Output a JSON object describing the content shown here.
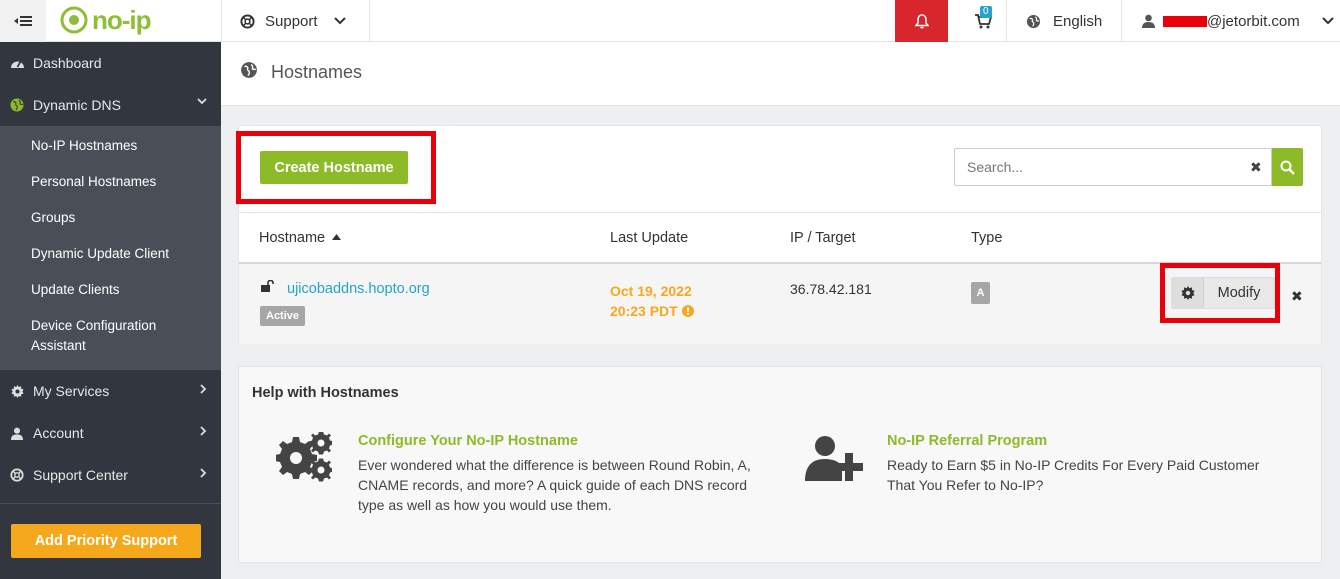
{
  "topbar": {
    "logo_text": "no-ip",
    "support_label": "Support",
    "cart_count": "0",
    "language": "English",
    "user_email_suffix": "@jetorbit.com"
  },
  "sidebar": {
    "dashboard": "Dashboard",
    "dynamic_dns": "Dynamic DNS",
    "sub_items": [
      "No-IP Hostnames",
      "Personal Hostnames",
      "Groups",
      "Dynamic Update Client",
      "Update Clients",
      "Device Configuration Assistant"
    ],
    "my_services": "My Services",
    "account": "Account",
    "support_center": "Support Center",
    "priority_button": "Add Priority Support"
  },
  "page": {
    "title": "Hostnames"
  },
  "hostnames": {
    "create_button": "Create Hostname",
    "search_placeholder": "Search...",
    "columns": {
      "hostname": "Hostname",
      "last_update": "Last Update",
      "ip_target": "IP / Target",
      "type": "Type"
    },
    "rows": [
      {
        "hostname": "ujicobaddns.hopto.org",
        "status": "Active",
        "last_update_date": "Oct 19, 2022",
        "last_update_time": "20:23 PDT",
        "ip": "36.78.42.181",
        "type": "A",
        "modify_label": "Modify"
      }
    ]
  },
  "help": {
    "title": "Help with Hostnames",
    "cards": [
      {
        "heading": "Configure Your No-IP Hostname",
        "body": "Ever wondered what the difference is between Round Robin, A, CNAME records, and more? A quick guide of each DNS record type as well as how you would use them."
      },
      {
        "heading": "No-IP Referral Program",
        "body": "Ready to Earn $5 in No-IP Credits For Every Paid Customer That You Refer to No-IP?"
      }
    ]
  },
  "colors": {
    "brand_green": "#8dbb27",
    "sidebar_bg": "#32363e",
    "alert_red": "#d7262c",
    "link_blue": "#28a3c8",
    "warning_orange": "#f5a81c"
  }
}
